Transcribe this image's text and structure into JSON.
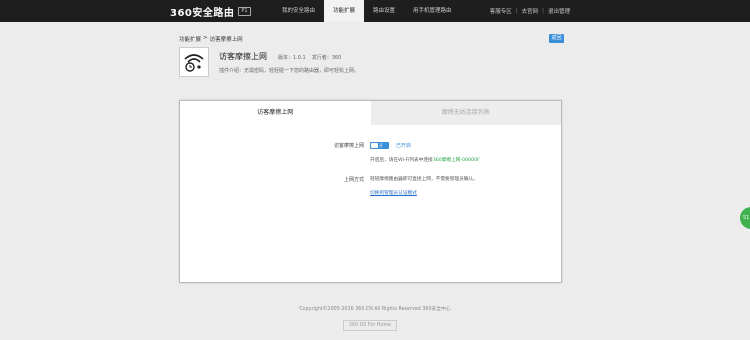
{
  "header": {
    "brand": "360安全路由",
    "model": "P1",
    "nav": [
      {
        "label": "我的安全路由",
        "active": false
      },
      {
        "label": "功能扩展",
        "active": true
      },
      {
        "label": "路由设置",
        "active": false
      },
      {
        "label": "用手机管理路由",
        "active": false
      }
    ],
    "links": {
      "help": "客服专区",
      "official": "去官网",
      "logout": "退出管理"
    }
  },
  "breadcrumb": {
    "parent": "功能扩展",
    "separator": ">",
    "current": "访客摩擦上网"
  },
  "back_button": "返回",
  "app": {
    "icon": "wifi-clock-icon",
    "name": "访客摩擦上网",
    "version": "版本：1.0.1",
    "publisher": "发行者：360",
    "description": "插件介绍：无需密码，轻轻碰一下您的路由器，即可轻松上网。"
  },
  "panel": {
    "tabs": [
      {
        "label": "访客摩擦上网",
        "active": true
      },
      {
        "label": "摩擦无线连接列表",
        "active": false
      }
    ],
    "toggle_label": "访客摩擦上网",
    "toggle_text": "开",
    "status": "已开启",
    "hint_prefix": "开启后，请在Wi-Fi列表中连接",
    "hint_ssid": "360摩擦上网-00000F",
    "method_label": "上网方式",
    "method_text": "轻轻摩擦路由器即可直接上网，不需要管理员确认。",
    "switch_link": "切换到管理员认证模式"
  },
  "footer": {
    "copyright": "Copyright©2005-2016 360.CN All Rights Reserved 360安全中心",
    "os": "360 OS For Home"
  },
  "float_badge": "51",
  "colors": {
    "accent": "#3b8fd8",
    "ssid_green": "#2aa84a",
    "topbar": "#1e1e1e"
  }
}
